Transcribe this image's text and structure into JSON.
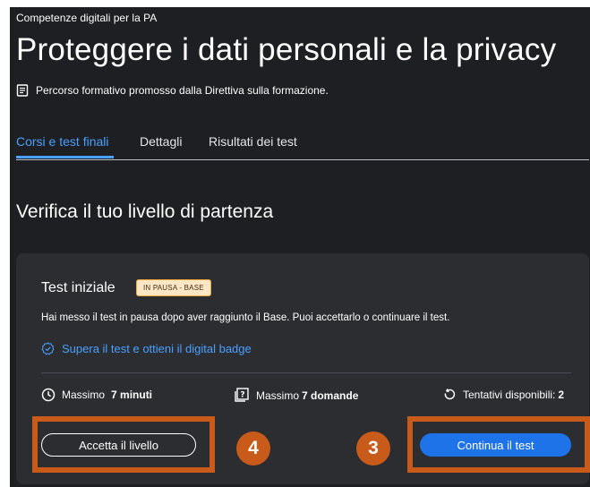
{
  "header": {
    "kicker": "Competenze digitali per la PA",
    "title": "Proteggere i dati personali e la privacy",
    "subtitle": "Percorso formativo promosso dalla Direttiva sulla formazione."
  },
  "tabs": [
    {
      "label": "Corsi e test finali",
      "active": true
    },
    {
      "label": "Dettagli",
      "active": false
    },
    {
      "label": "Risultati dei test",
      "active": false
    }
  ],
  "section": {
    "title": "Verifica il tuo livello di partenza"
  },
  "card": {
    "title": "Test iniziale",
    "badge": "IN PAUSA - BASE",
    "description": "Hai messo il test in pausa dopo aver raggiunto il Base. Puoi accettarlo o continuare il test.",
    "link": "Supera il test e ottieni il digital badge",
    "stats": {
      "time_label": "Massimo",
      "time_value": "7 minuti",
      "questions_label": "Massimo",
      "questions_value": "7 domande",
      "attempts_label": "Tentativi disponibili:",
      "attempts_value": "2"
    },
    "accept_button": "Accetta il livello",
    "continue_button": "Continua il test"
  },
  "annotations": {
    "left_number": "4",
    "right_number": "3",
    "highlight_color": "#c85a1a"
  },
  "colors": {
    "accent": "#4aa0ff",
    "primary_button": "#1f73e8",
    "background": "#1e1f22",
    "card": "#2b2d31"
  }
}
